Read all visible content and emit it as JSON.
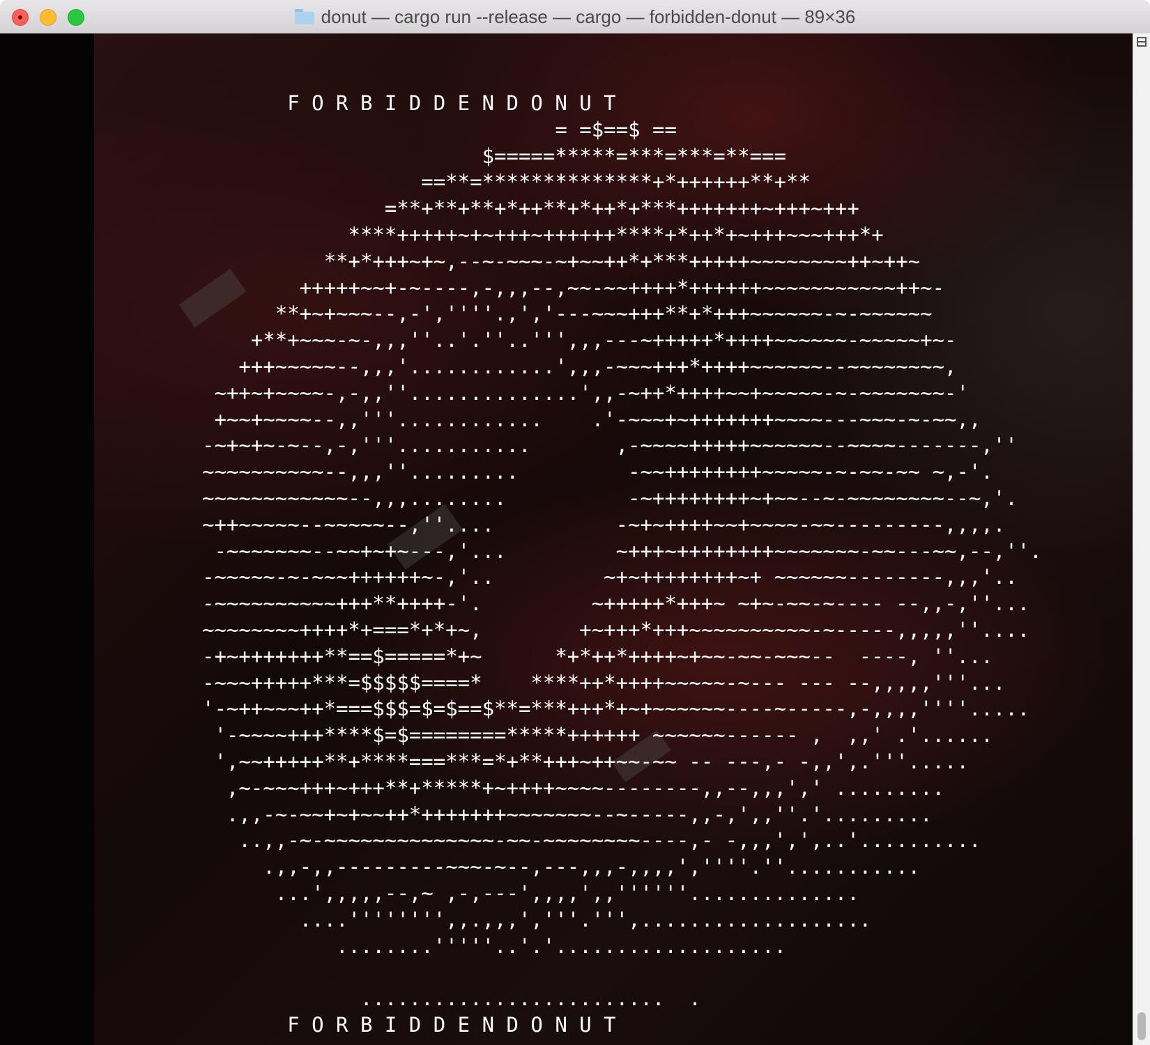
{
  "window": {
    "title": "donut — cargo run --release — cargo — forbidden-donut — 89×36",
    "folder_icon": "folder-icon"
  },
  "terminal": {
    "lines": [
      "       F O R B I D D E N D O N U T",
      "                             = =$==$ ==",
      "                       $=====*****=***=***=**===",
      "                  ==**=**************+*++++++**+**",
      "               =**+**+**+*++**+*++*+***+++++++~+++~+++",
      "            ****+++++~+~+++~++++++****+*++*+~+++~~~+++*+",
      "          **+*+++~+~,--~-~~~-~+~~++*+***+++++~~~~~~~~++~++~",
      "        +++++~~+-~----,-,,,--,~~-~~++++*++++++~~~~~~~~~~~++~-",
      "      **+~+~~~--,-',''''.,','---~~~+++**+*+++~~~~~~-~-~~~~~~",
      "    +**+~~~-~-,,,''..'.''..''',,,---~+++++*++++~~~~~~-~~~~~+~-",
      "   +++~~~~~--,,,'............',,,-~~~+++*++++~~~~~~--~~~~~~~~,",
      " ~++~+~~~~-,-,,''..............',,-~++*++++~~+~~~~~-~-~~~~~~~-'",
      " +~~+~~~~--,,'''............    .'-~~~+~+++++++~~~~---~~~-~-~~,,",
      "-~+~+~-~--,-,'''...........       ,-~~~~+++++~~~~~~--~~~~-------,''",
      "~~~~~~~~~~--,,,''.........         -~~++++++++~~~~~-~-~~-~~ ~,-'.",
      "~~~~~~~~~~~~--,,,........          -~++++++++~+~~--~-~~~~~~~~--~,'.",
      "~++~~~~~--~~~~~--,''....          -~+~++++~~+~~~~-~~---------,,,,.",
      " -~~~~~~~--~~+~+~---,'...         ~+++~++++++++~~~~~~~-~~---~~,--,''.",
      "-~~~~~-~-~~~++++++~-,'..         ~+~++++++++~+ ~~~~~~--------,,,'..",
      "-~~~~~~~~~~+++**++++-'.         ~+++++*+++~ ~+~-~~-~---- --,,-,''...",
      "~~~~~~~~++++*+===*+*+~,        +~+++*+++~~~~~~~~~~-~-----,,,,,''....",
      "-+~+++++++**==$=====*+~      *+*++*++++~+~~-~~-~~~--  ----, ''...",
      "-~~~+++++***=$$$$$====*    ****++*++++~~~~~-~--- --- --,,,,,'''...",
      "'-~++~~~++*===$$$=$=$==$**=***+++*+~+~~~~~~----~-----,-,,,,''''.....",
      " '-~~~~+++****$=$========*****++++++ ~~~~~~------ ,  ,,' .'......",
      " ',~~+++++**+****===***=*+**+++~++~~-~~ -- ---,- -,,',.'''.....",
      "  ,~-~~~+++~+++**+*****+~++++~~~~--------,,--,,,',' .........",
      "  .,,-~-~~+~+~~++*+++++++~~~~~~~--~-----,,-,',,''.'.........",
      "   ..,,-~-~~~~~~~~~~~~~~-~~-~~~~~~~~----,- -,,,',',..'..........",
      "     .,,-,,---------~~~-~--,---,,,-,,,,',''''.''...........",
      "      ...',,,,,--,~ ,-,---',,,,',,''''''..............",
      "        ....'''''''',,.,,,','''.''',...................",
      "           ........'''''..'.'...................",
      "",
      "             .........................  .",
      "       F O R B I D D E N D O N U T"
    ]
  }
}
